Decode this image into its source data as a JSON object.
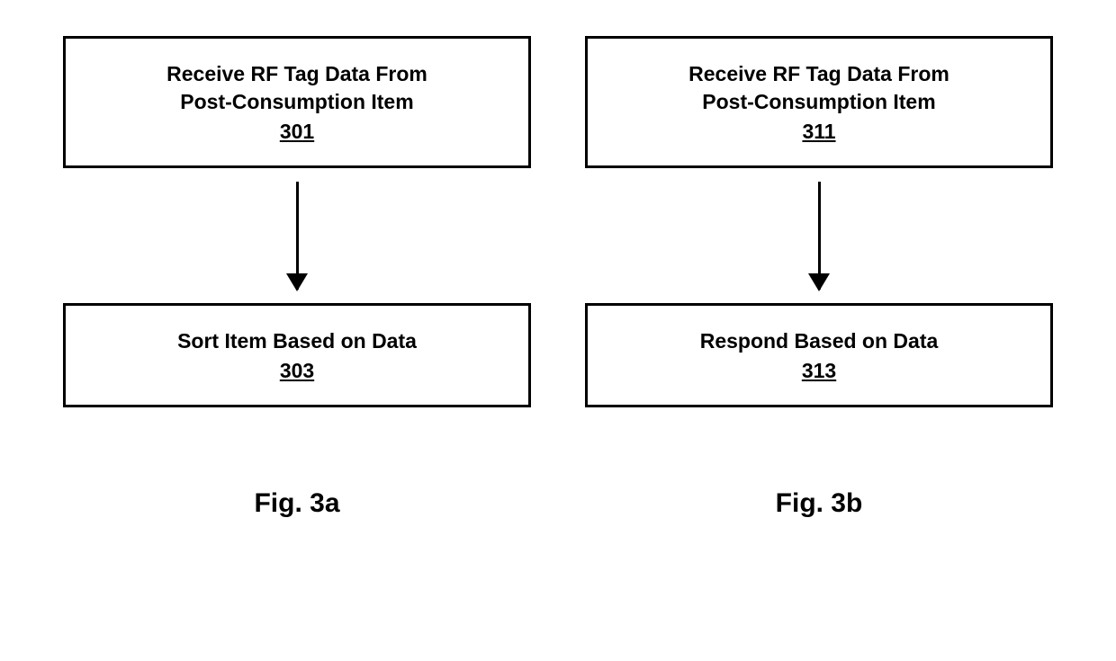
{
  "figures": [
    {
      "label": "Fig. 3a",
      "step1": {
        "title": "Receive RF Tag Data From\nPost-Consumption Item",
        "ref": "301"
      },
      "step2": {
        "title": "Sort Item Based on Data",
        "ref": "303"
      }
    },
    {
      "label": "Fig. 3b",
      "step1": {
        "title": "Receive RF Tag Data From\nPost-Consumption Item",
        "ref": "311"
      },
      "step2": {
        "title": "Respond Based on Data",
        "ref": "313"
      }
    }
  ]
}
